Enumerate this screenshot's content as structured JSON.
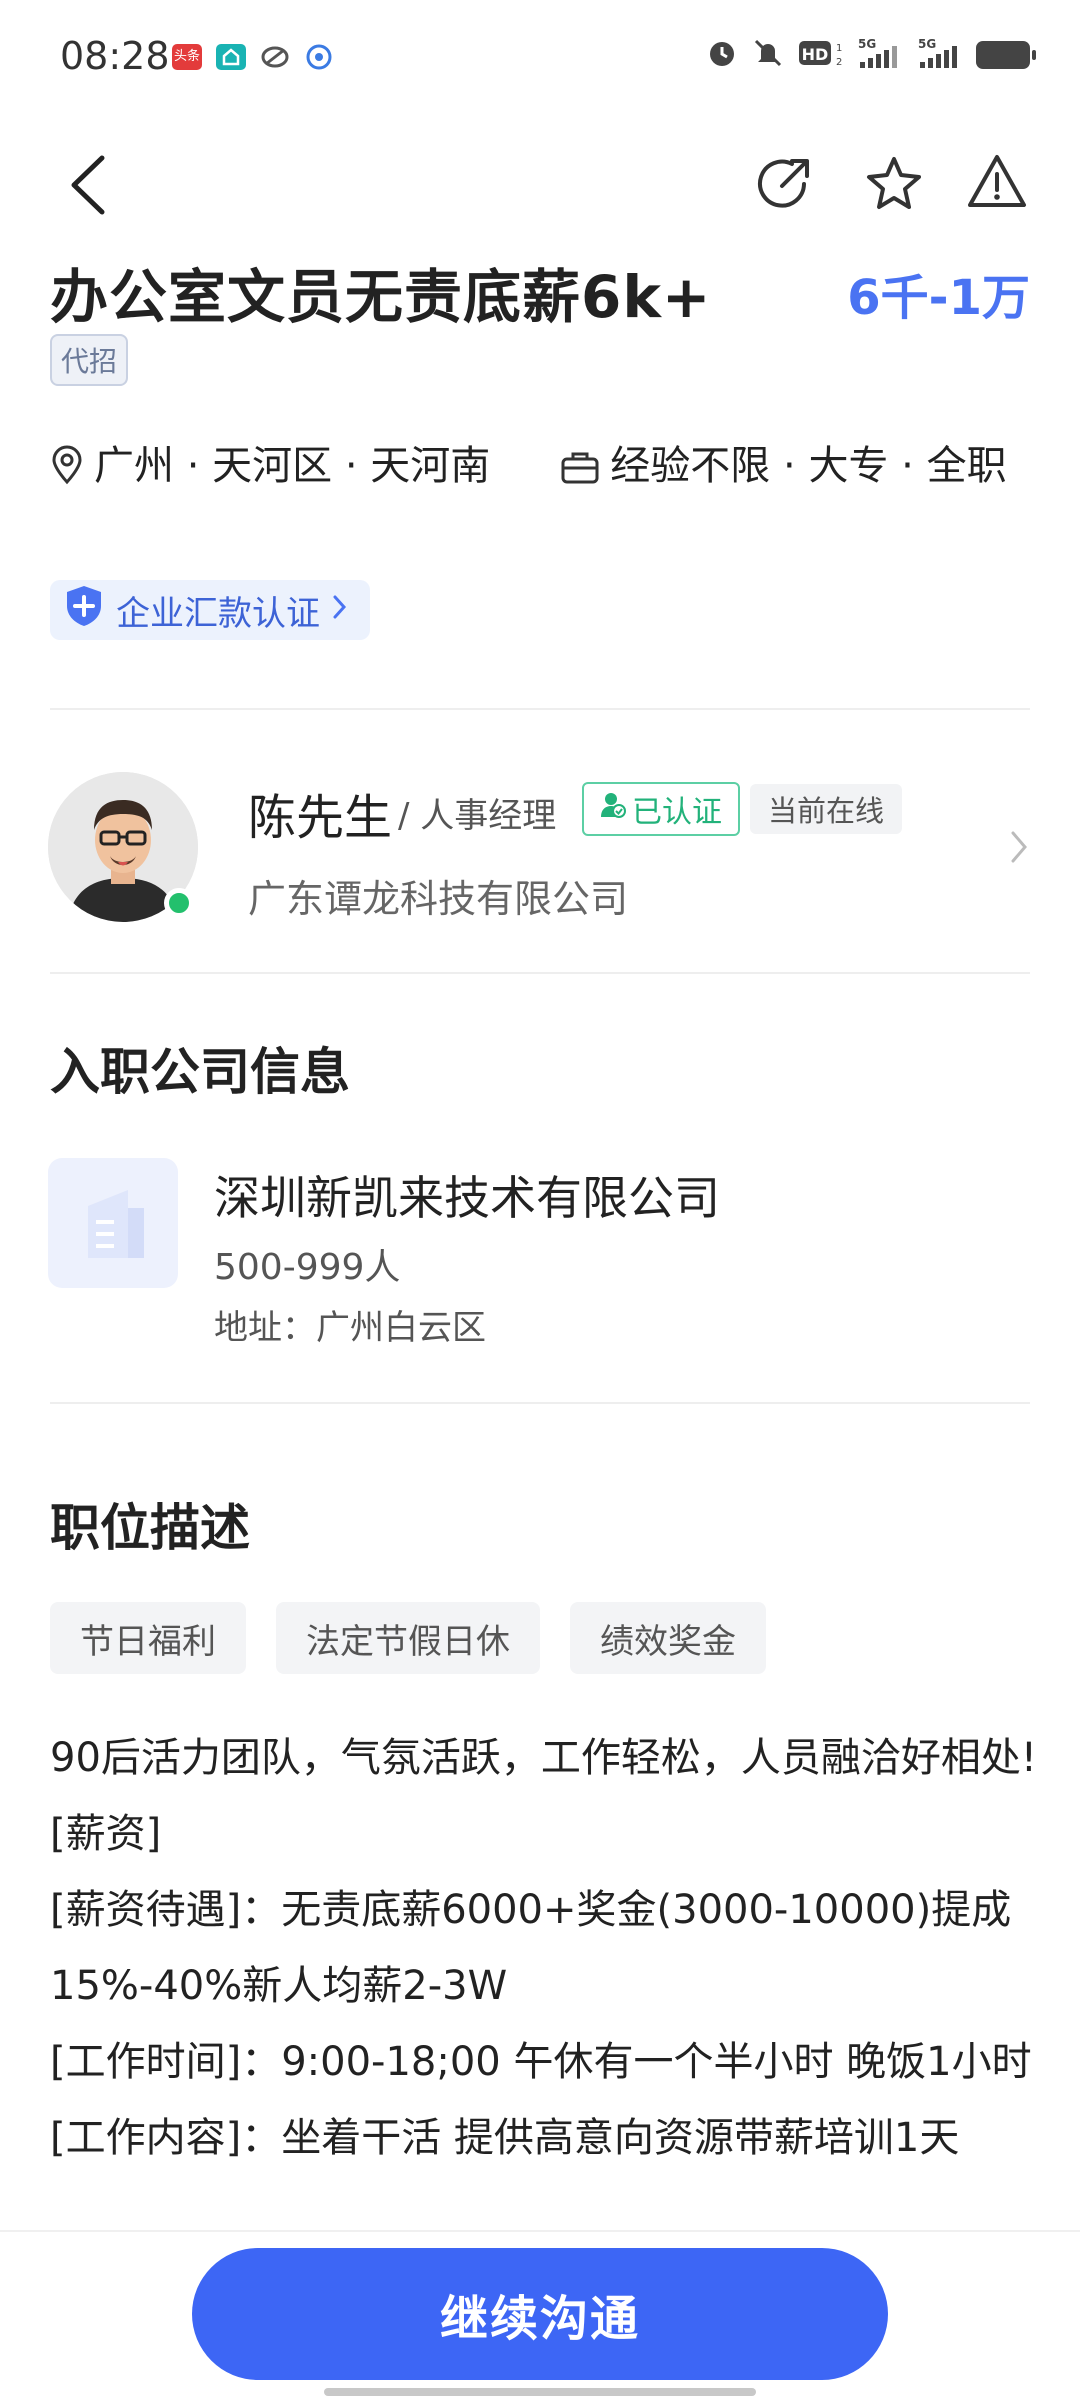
{
  "status_bar": {
    "time": "08:28",
    "apps": [
      {
        "name": "toutiao-icon",
        "text": "头条",
        "color": "#e33b3b"
      },
      {
        "name": "home-app-icon",
        "color": "#19b3b3"
      },
      {
        "name": "link-app-icon",
        "color": "#555555"
      },
      {
        "name": "ifly-app-icon",
        "color": "#3b7be3"
      }
    ],
    "icons": [
      "alarm-icon",
      "mute-icon",
      "hd-icon",
      "signal-5g-icon",
      "signal-5g-icon",
      "battery-icon"
    ]
  },
  "nav": {
    "icons": [
      "back-icon",
      "share-icon",
      "star-icon",
      "warning-icon"
    ]
  },
  "job": {
    "title": "办公室文员无责底薪6k+",
    "salary": "6千-1万",
    "tag": "代招",
    "location": "广州 · 天河区 · 天河南",
    "requirements": "经验不限 · 大专 · 全职",
    "certification": "企业汇款认证"
  },
  "recruiter": {
    "name": "陈先生",
    "role": "/ 人事经理",
    "verified": "已认证",
    "status": "当前在线",
    "company": "广东谭龙科技有限公司"
  },
  "company_section": {
    "title": "入职公司信息",
    "name": "深圳新凯来技术有限公司",
    "size": "500-999人",
    "address": "地址：广州白云区"
  },
  "description_section": {
    "title": "职位描述",
    "tags": [
      "节日福利",
      "法定节假日休",
      "绩效奖金"
    ],
    "lines": [
      "90后活力团队，气氛活跃，工作轻松，人员融洽好相处![薪资]",
      "[薪资待遇]：无责底薪6000+奖金(3000-10000)提成15%-40%新人均薪2-3W",
      "[工作时间]：9:00-18;00 午休有一个半小时 晚饭1小时",
      "[工作内容]：坐着干活 提供高意向资源带薪培训1天"
    ]
  },
  "cta": {
    "label": "继续沟通"
  },
  "colors": {
    "accent": "#3d66f5",
    "salary": "#4a73f2",
    "verified": "#22b27a",
    "online": "#23c06d"
  }
}
